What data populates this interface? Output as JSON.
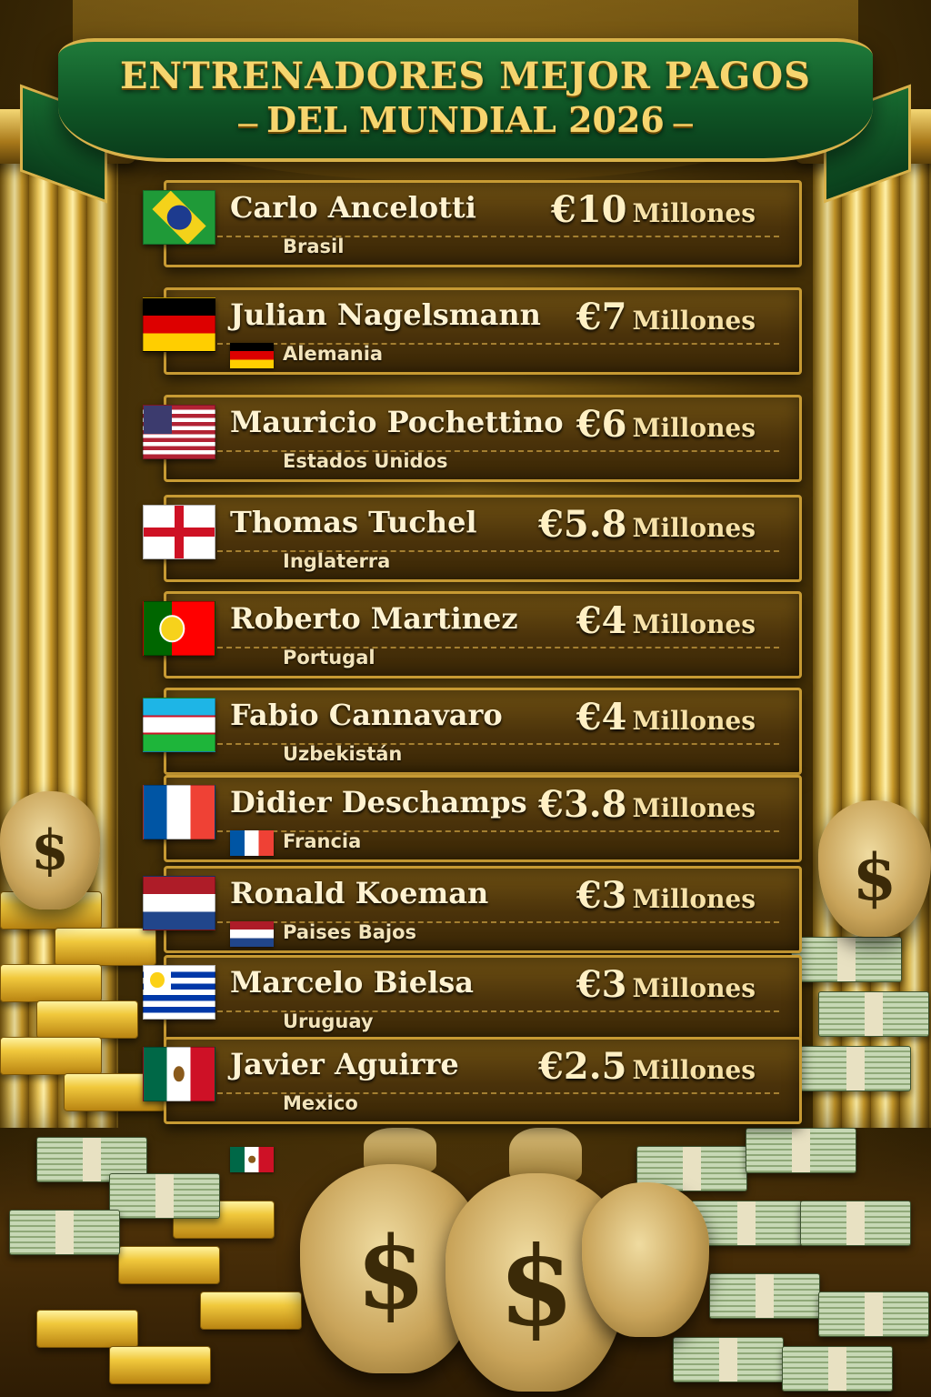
{
  "banner": {
    "title": "ENTRENADORES MEJOR PAGOS",
    "subtitle": "DEL MUNDIAL 2026"
  },
  "colors": {
    "banner_green": "#0f5626",
    "gold": "#d9b24a",
    "panel_brown": "#4a320a"
  },
  "coaches": [
    {
      "name": "Carlo Ancelotti",
      "country": "Brasil",
      "amount": "€10",
      "unit": "Millones",
      "flag": "brazil-flag"
    },
    {
      "name": "Julian Nagelsmann",
      "country": "Alemania",
      "amount": "€7",
      "unit": "Millones",
      "flag": "germany-flag"
    },
    {
      "name": "Mauricio Pochettino",
      "country": "Estados Unidos",
      "amount": "€6",
      "unit": "Millones",
      "flag": "usa-flag"
    },
    {
      "name": "Thomas Tuchel",
      "country": "Inglaterra",
      "amount": "€5.8",
      "unit": "Millones",
      "flag": "england-flag"
    },
    {
      "name": "Roberto Martinez",
      "country": "Portugal",
      "amount": "€4",
      "unit": "Millones",
      "flag": "portugal-flag"
    },
    {
      "name": "Fabio Cannavaro",
      "country": "Uzbekistán",
      "amount": "€4",
      "unit": "Millones",
      "flag": "uzbekistan-flag"
    },
    {
      "name": "Didier Deschamps",
      "country": "Francia",
      "amount": "€3.8",
      "unit": "Millones",
      "flag": "france-flag"
    },
    {
      "name": "Ronald Koeman",
      "country": "Paises Bajos",
      "amount": "€3",
      "unit": "Millones",
      "flag": "netherlands-flag"
    },
    {
      "name": "Marcelo Bielsa",
      "country": "Uruguay",
      "amount": "€3",
      "unit": "Millones",
      "flag": "uruguay-flag"
    },
    {
      "name": "Javier Aguirre",
      "country": "Mexico",
      "amount": "€2.5",
      "unit": "Millones",
      "flag": "mexico-flag"
    }
  ],
  "decor": {
    "money_symbol": "$"
  }
}
